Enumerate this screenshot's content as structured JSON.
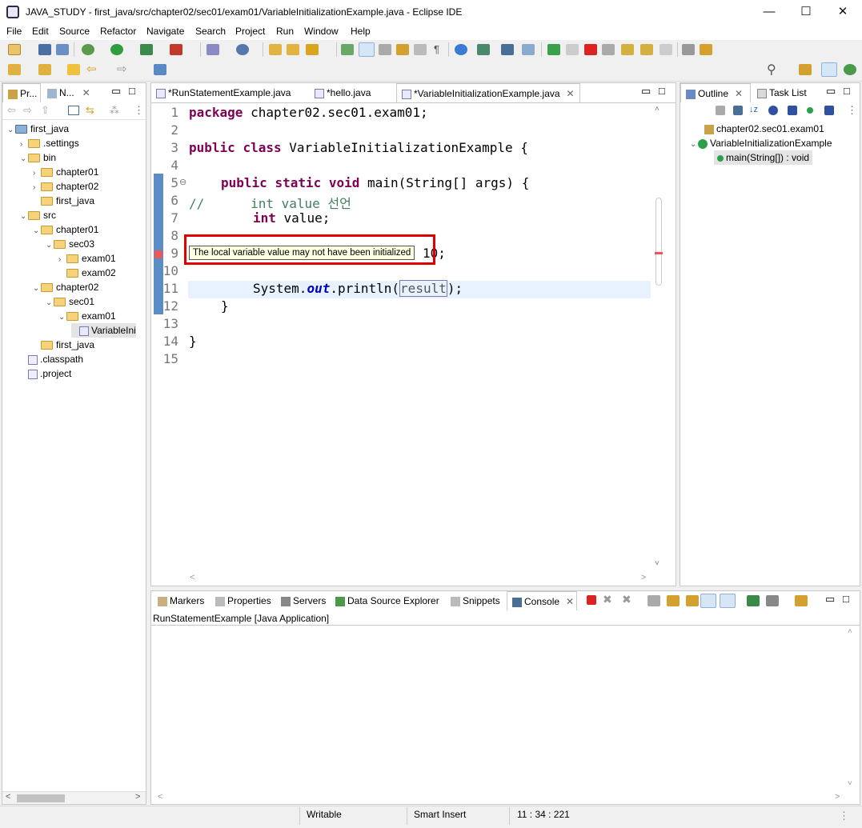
{
  "window": {
    "title": "JAVA_STUDY - first_java/src/chapter02/sec01/exam01/VariableInitializationExample.java - Eclipse IDE",
    "minimize": "—",
    "maximize": "☐",
    "close": "✕"
  },
  "menu": [
    "File",
    "Edit",
    "Source",
    "Refactor",
    "Navigate",
    "Search",
    "Project",
    "Run",
    "Window",
    "Help"
  ],
  "left_panel": {
    "tabs": [
      "Pr...",
      "N..."
    ],
    "tree": [
      {
        "label": "first_java",
        "depth": 0,
        "kind": "project",
        "expanded": true
      },
      {
        "label": ".settings",
        "depth": 1,
        "kind": "folder",
        "expanded": false
      },
      {
        "label": "bin",
        "depth": 1,
        "kind": "folder",
        "expanded": true
      },
      {
        "label": "chapter01",
        "depth": 2,
        "kind": "folder",
        "expanded": false
      },
      {
        "label": "chapter02",
        "depth": 2,
        "kind": "folder",
        "expanded": false
      },
      {
        "label": "first_java",
        "depth": 2,
        "kind": "folder",
        "expanded": null
      },
      {
        "label": "src",
        "depth": 1,
        "kind": "folder",
        "expanded": true
      },
      {
        "label": "chapter01",
        "depth": 2,
        "kind": "folder",
        "expanded": true
      },
      {
        "label": "sec03",
        "depth": 3,
        "kind": "folder",
        "expanded": true
      },
      {
        "label": "exam01",
        "depth": 4,
        "kind": "folder",
        "expanded": false
      },
      {
        "label": "exam02",
        "depth": 4,
        "kind": "folder",
        "expanded": null
      },
      {
        "label": "chapter02",
        "depth": 2,
        "kind": "folder",
        "expanded": true
      },
      {
        "label": "sec01",
        "depth": 3,
        "kind": "folder",
        "expanded": true
      },
      {
        "label": "exam01",
        "depth": 4,
        "kind": "folder",
        "expanded": true
      },
      {
        "label": "VariableIni",
        "depth": 5,
        "kind": "file",
        "expanded": null
      },
      {
        "label": "first_java",
        "depth": 2,
        "kind": "folder",
        "expanded": null
      },
      {
        "label": ".classpath",
        "depth": 1,
        "kind": "xfile",
        "expanded": null
      },
      {
        "label": ".project",
        "depth": 1,
        "kind": "xfile",
        "expanded": null
      }
    ]
  },
  "editor": {
    "tabs": [
      {
        "label": "*RunStatementExample.java",
        "active": false
      },
      {
        "label": "*hello.java",
        "active": false
      },
      {
        "label": "*VariableInitializationExample.java",
        "active": true
      }
    ],
    "line_numbers": [
      "1",
      "2",
      "3",
      "4",
      "5",
      "6",
      "7",
      "8",
      "9",
      "10",
      "11",
      "12",
      "13",
      "14",
      "15"
    ],
    "lines": {
      "l1_kw": "package",
      "l1_rest": " chapter02.sec01.exam01;",
      "l3_kw1": "public",
      "l3_kw2": "class",
      "l3_rest": " VariableInitializationExample {",
      "l5_kw1": "public",
      "l5_kw2": "static",
      "l5_kw3": "void",
      "l5_rest": " main(String[] args) {",
      "l6_comment": "//      int value 선언",
      "l7_kw": "int",
      "l7_rest": " value;",
      "l9_visible": "10;",
      "l11_a": "System.",
      "l11_field": "out",
      "l11_b": ".println(",
      "l11_arg": "result",
      "l11_c": ");",
      "l12": "}",
      "l14": "}"
    },
    "fold_marker": "⊖",
    "tooltip": "The local variable value may not have been initialized"
  },
  "outline": {
    "tabs": [
      "Outline",
      "Task List"
    ],
    "items": [
      {
        "label": "chapter02.sec01.exam01"
      },
      {
        "label": "VariableInitializationExample"
      },
      {
        "label": "main(String[]) : void"
      }
    ]
  },
  "bottom": {
    "tabs": [
      "Markers",
      "Properties",
      "Servers",
      "Data Source Explorer",
      "Snippets",
      "Console"
    ],
    "console_title": "RunStatementExample [Java Application]"
  },
  "status": {
    "writable": "Writable",
    "insert_mode": "Smart Insert",
    "position": "11 : 34 : 221"
  }
}
